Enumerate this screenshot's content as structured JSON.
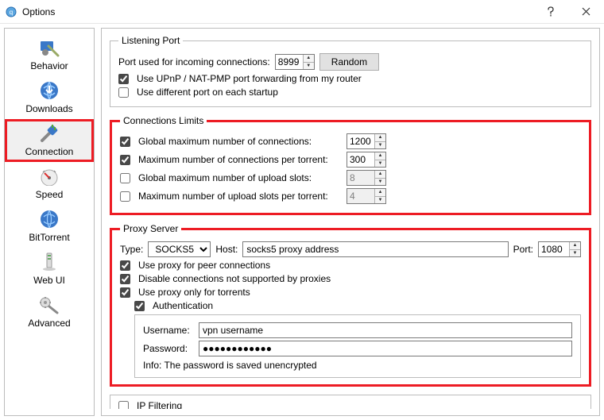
{
  "window": {
    "title": "Options"
  },
  "sidebar": {
    "items": [
      {
        "label": "Behavior"
      },
      {
        "label": "Downloads"
      },
      {
        "label": "Connection"
      },
      {
        "label": "Speed"
      },
      {
        "label": "BitTorrent"
      },
      {
        "label": "Web UI"
      },
      {
        "label": "Advanced"
      }
    ]
  },
  "listeningPort": {
    "legend": "Listening Port",
    "portLabel": "Port used for incoming connections:",
    "portValue": "8999",
    "randomLabel": "Random",
    "upnpLabel": "Use UPnP / NAT-PMP port forwarding from my router",
    "diffPortLabel": "Use different port on each startup"
  },
  "connLimits": {
    "legend": "Connections Limits",
    "globalMaxConn": {
      "label": "Global maximum number of connections:",
      "value": "1200"
    },
    "maxConnPerTorrent": {
      "label": "Maximum number of connections per torrent:",
      "value": "300"
    },
    "globalMaxUpload": {
      "label": "Global maximum number of upload slots:",
      "value": "8"
    },
    "maxUploadPerTorrent": {
      "label": "Maximum number of upload slots per torrent:",
      "value": "4"
    }
  },
  "proxy": {
    "legend": "Proxy Server",
    "typeLabel": "Type:",
    "typeValue": "SOCKS5",
    "hostLabel": "Host:",
    "hostValue": "socks5 proxy address",
    "portLabel": "Port:",
    "portValue": "1080",
    "usePeerLabel": "Use proxy for peer connections",
    "disableUnsupportedLabel": "Disable connections not supported by proxies",
    "onlyTorrentsLabel": "Use proxy only for torrents",
    "authLabel": "Authentication",
    "usernameLabel": "Username:",
    "usernameValue": "vpn username",
    "passwordLabel": "Password:",
    "passwordValue": "●●●●●●●●●●●●",
    "infoLabel": "Info: The password is saved unencrypted"
  },
  "ipFiltering": {
    "label": "IP Filtering"
  }
}
